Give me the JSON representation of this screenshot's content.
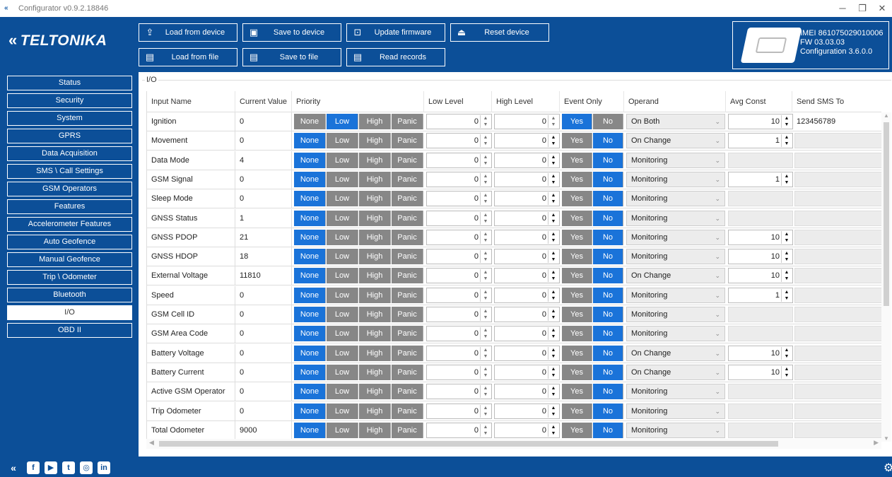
{
  "window": {
    "title": "Configurator v0.9.2.18846"
  },
  "brand": {
    "logo_text": "TELTONIKA",
    "primary_color": "#0c4f98",
    "accent_color": "#1a73d9"
  },
  "toolbar": {
    "load_device": "Load from device",
    "save_device": "Save to device",
    "update_firmware": "Update firmware",
    "reset_device": "Reset device",
    "load_file": "Load from file",
    "save_file": "Save to file",
    "read_records": "Read records"
  },
  "device": {
    "imei": "IMEI 861075029010006",
    "fw": "FW 03.03.03",
    "config": "Configuration 3.6.0.0"
  },
  "sidebar": {
    "items": [
      "Status",
      "Security",
      "System",
      "GPRS",
      "Data Acquisition",
      "SMS \\ Call Settings",
      "GSM Operators",
      "Features",
      "Accelerometer Features",
      "Auto Geofence",
      "Manual Geofence",
      "Trip \\ Odometer",
      "Bluetooth",
      "I/O",
      "OBD II"
    ],
    "active": "I/O"
  },
  "section": {
    "title": "I/O"
  },
  "table": {
    "headers": [
      "Input Name",
      "Current Value",
      "Priority",
      "Low Level",
      "High Level",
      "Event Only",
      "Operand",
      "Avg Const",
      "Send SMS To"
    ],
    "priority_labels": [
      "None",
      "Low",
      "High",
      "Panic"
    ],
    "event_labels": [
      "Yes",
      "No"
    ],
    "rows": [
      {
        "name": "Ignition",
        "value": "0",
        "priority": "Low",
        "low": "0",
        "high": "0",
        "event": "Yes",
        "operand": "On Both",
        "avg": "10",
        "sms": "123456789"
      },
      {
        "name": "Movement",
        "value": "0",
        "priority": "None",
        "low": "0",
        "high": "0",
        "event": "No",
        "operand": "On Change",
        "avg": "1",
        "sms": ""
      },
      {
        "name": "Data Mode",
        "value": "4",
        "priority": "None",
        "low": "0",
        "high": "0",
        "event": "No",
        "operand": "Monitoring",
        "avg": "",
        "sms": ""
      },
      {
        "name": "GSM Signal",
        "value": "0",
        "priority": "None",
        "low": "0",
        "high": "0",
        "event": "No",
        "operand": "Monitoring",
        "avg": "1",
        "sms": ""
      },
      {
        "name": "Sleep Mode",
        "value": "0",
        "priority": "None",
        "low": "0",
        "high": "0",
        "event": "No",
        "operand": "Monitoring",
        "avg": "",
        "sms": ""
      },
      {
        "name": "GNSS Status",
        "value": "1",
        "priority": "None",
        "low": "0",
        "high": "0",
        "event": "No",
        "operand": "Monitoring",
        "avg": "",
        "sms": ""
      },
      {
        "name": "GNSS PDOP",
        "value": "21",
        "priority": "None",
        "low": "0",
        "high": "0",
        "event": "No",
        "operand": "Monitoring",
        "avg": "10",
        "sms": ""
      },
      {
        "name": "GNSS HDOP",
        "value": "18",
        "priority": "None",
        "low": "0",
        "high": "0",
        "event": "No",
        "operand": "Monitoring",
        "avg": "10",
        "sms": ""
      },
      {
        "name": "External Voltage",
        "value": "11810",
        "priority": "None",
        "low": "0",
        "high": "0",
        "event": "No",
        "operand": "On Change",
        "avg": "10",
        "sms": ""
      },
      {
        "name": "Speed",
        "value": "0",
        "priority": "None",
        "low": "0",
        "high": "0",
        "event": "No",
        "operand": "Monitoring",
        "avg": "1",
        "sms": ""
      },
      {
        "name": "GSM Cell ID",
        "value": "0",
        "priority": "None",
        "low": "0",
        "high": "0",
        "event": "No",
        "operand": "Monitoring",
        "avg": "",
        "sms": ""
      },
      {
        "name": "GSM Area Code",
        "value": "0",
        "priority": "None",
        "low": "0",
        "high": "0",
        "event": "No",
        "operand": "Monitoring",
        "avg": "",
        "sms": ""
      },
      {
        "name": "Battery Voltage",
        "value": "0",
        "priority": "None",
        "low": "0",
        "high": "0",
        "event": "No",
        "operand": "On Change",
        "avg": "10",
        "sms": ""
      },
      {
        "name": "Battery Current",
        "value": "0",
        "priority": "None",
        "low": "0",
        "high": "0",
        "event": "No",
        "operand": "On Change",
        "avg": "10",
        "sms": ""
      },
      {
        "name": "Active GSM Operator",
        "value": "0",
        "priority": "None",
        "low": "0",
        "high": "0",
        "event": "No",
        "operand": "Monitoring",
        "avg": "",
        "sms": ""
      },
      {
        "name": "Trip Odometer",
        "value": "0",
        "priority": "None",
        "low": "0",
        "high": "0",
        "event": "No",
        "operand": "Monitoring",
        "avg": "",
        "sms": ""
      },
      {
        "name": "Total Odometer",
        "value": "9000",
        "priority": "None",
        "low": "0",
        "high": "0",
        "event": "No",
        "operand": "Monitoring",
        "avg": "",
        "sms": ""
      }
    ]
  },
  "footer": {
    "social_icons": [
      "teltonika-icon",
      "facebook-icon",
      "youtube-icon",
      "twitter-icon",
      "instagram-icon",
      "linkedin-icon"
    ]
  }
}
